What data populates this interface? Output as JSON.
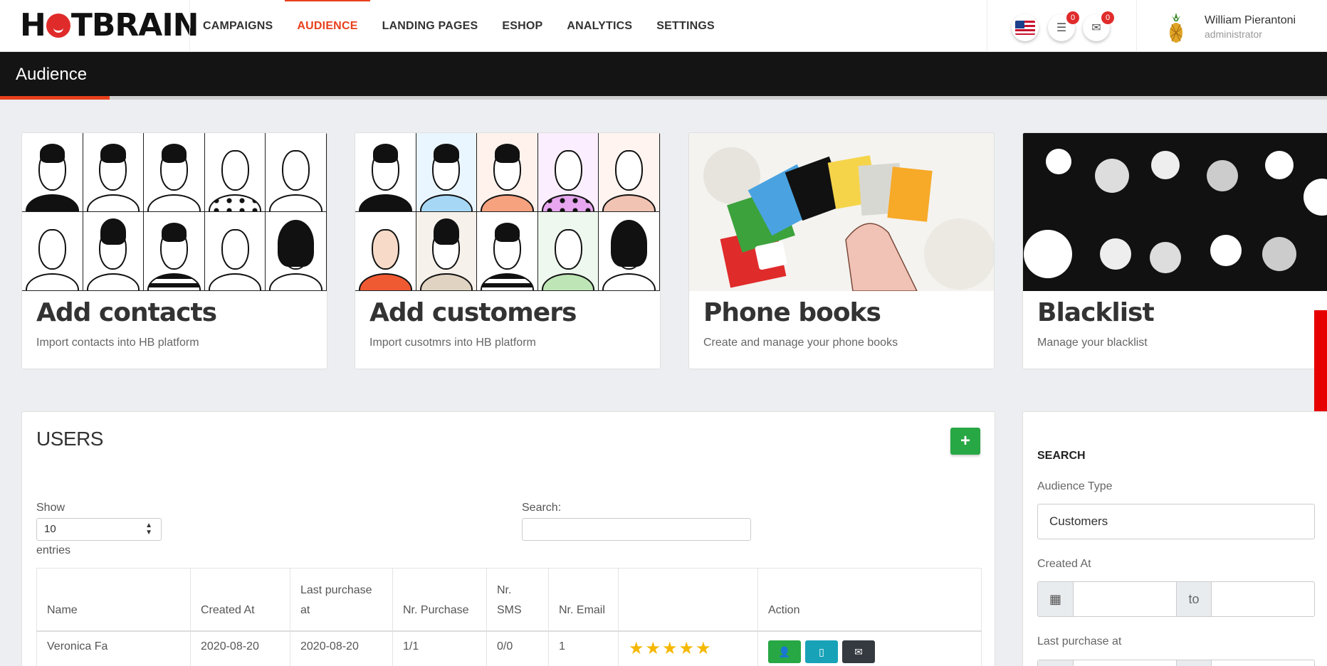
{
  "brand": {
    "name_left": "H",
    "name_right": "TBRAIN"
  },
  "nav": {
    "items": [
      {
        "label": "CAMPAIGNS",
        "active": false
      },
      {
        "label": "AUDIENCE",
        "active": true
      },
      {
        "label": "LANDING PAGES",
        "active": false
      },
      {
        "label": "ESHOP",
        "active": false
      },
      {
        "label": "ANALYTICS",
        "active": false
      },
      {
        "label": "SETTINGS",
        "active": false
      }
    ],
    "tasks_count": "0",
    "messages_count": "0"
  },
  "user": {
    "name": "William Pierantoni",
    "role": "administrator"
  },
  "page": {
    "title": "Audience"
  },
  "cards": [
    {
      "title": "Add contacts",
      "subtitle": "Import contacts into HB platform"
    },
    {
      "title": "Add customers",
      "subtitle": "Import cusotmrs into HB platform"
    },
    {
      "title": "Phone books",
      "subtitle": "Create and manage your phone books"
    },
    {
      "title": "Blacklist",
      "subtitle": "Manage your blacklist"
    }
  ],
  "users": {
    "title": "USERS",
    "add_label": "+",
    "show_label": "Show",
    "entries_value": "10",
    "entries_label": "entries",
    "search_label": "Search:",
    "columns": [
      "Name",
      "Created At",
      "Last purchase at",
      "Nr. Purchase",
      "Nr. SMS",
      "Nr. Email",
      "",
      "Action"
    ],
    "rows": [
      {
        "name": "Veronica Fa",
        "created_at": "2020-08-20",
        "last_purchase": "2020-08-20",
        "nr_purchase": "1/1",
        "nr_sms": "0/0",
        "nr_email": "1",
        "rating": 5
      }
    ]
  },
  "search": {
    "title": "SEARCH",
    "audience_type_label": "Audience Type",
    "audience_type_value": "Customers",
    "created_at_label": "Created At",
    "to_label": "to",
    "last_purchase_label": "Last purchase at"
  },
  "colors": {
    "accent": "#e8401c",
    "primary_green": "#28a745",
    "teal": "#17a2b8",
    "dark": "#343a40",
    "badge": "#e02b2b"
  }
}
